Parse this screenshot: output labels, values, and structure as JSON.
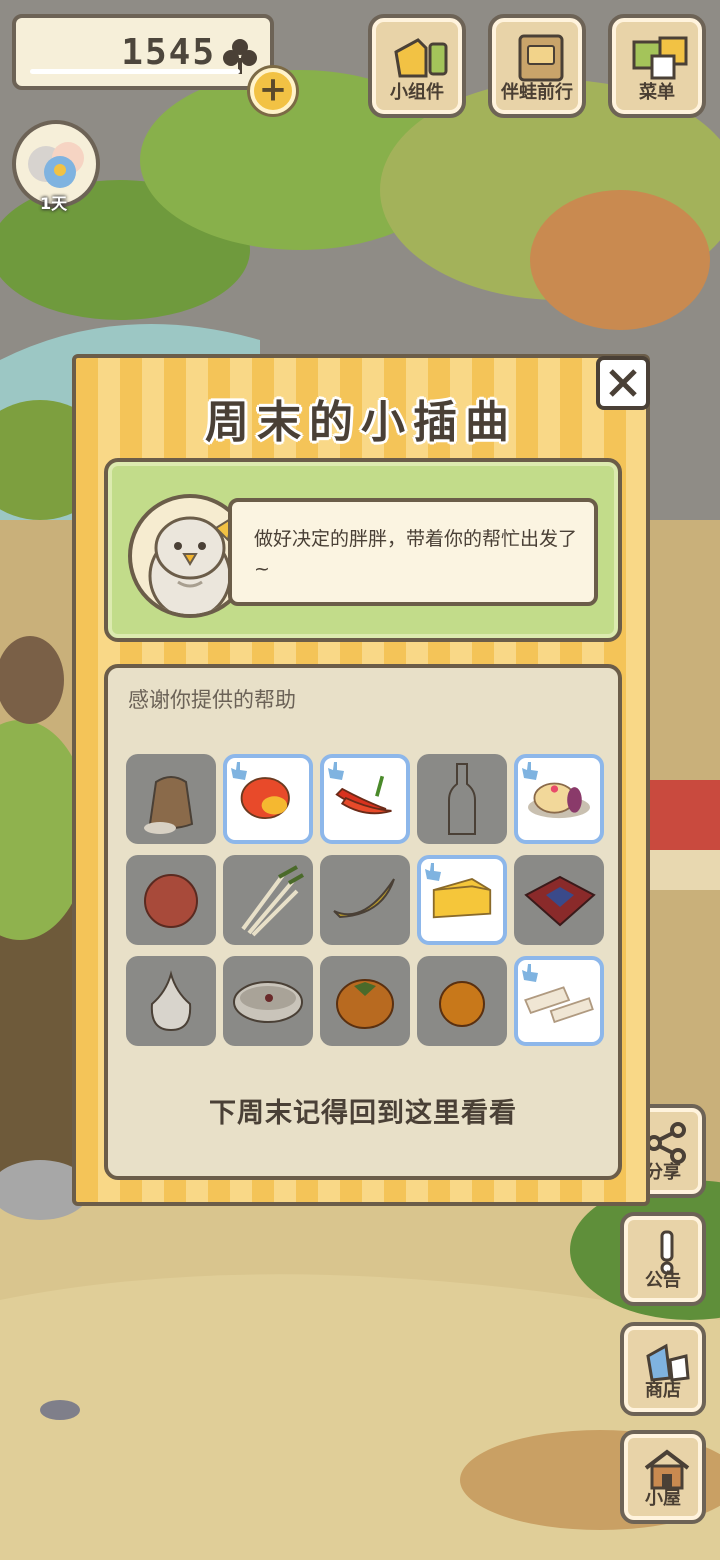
{
  "hud": {
    "clover_count": "1545",
    "clover_icon": "clover-icon",
    "plus_label": "+",
    "days_label": "1天"
  },
  "top_menu": [
    {
      "label": "小组件",
      "icon": "widget-icon"
    },
    {
      "label": "伴蛙前行",
      "icon": "book-icon"
    },
    {
      "label": "菜单",
      "icon": "menu-cards-icon"
    }
  ],
  "side_menu": [
    {
      "label": "分享",
      "icon": "share-icon"
    },
    {
      "label": "公告",
      "icon": "notice-icon"
    },
    {
      "label": "商店",
      "icon": "shop-bag-icon"
    },
    {
      "label": "小屋",
      "icon": "house-icon"
    }
  ],
  "modal": {
    "title": "周末的小插曲",
    "message": "做好决定的胖胖，带着你的帮忙出发了~",
    "thanks_heading": "感谢你提供的帮助",
    "footer": "下周末记得回到这里看看",
    "items": [
      {
        "name": "rice-sack",
        "given": false
      },
      {
        "name": "mango",
        "given": true
      },
      {
        "name": "chili-peppers",
        "given": true
      },
      {
        "name": "glass-bottle",
        "given": false
      },
      {
        "name": "pastry-cake",
        "given": true
      },
      {
        "name": "peach",
        "given": false
      },
      {
        "name": "green-onion",
        "given": false
      },
      {
        "name": "banana",
        "given": false
      },
      {
        "name": "cheese",
        "given": true
      },
      {
        "name": "gift-box",
        "given": false
      },
      {
        "name": "garlic",
        "given": false
      },
      {
        "name": "porridge-bowl",
        "given": false
      },
      {
        "name": "persimmon",
        "given": false
      },
      {
        "name": "orange",
        "given": false
      },
      {
        "name": "nougat",
        "given": true
      }
    ]
  },
  "colors": {
    "modal_stripe_a": "#f4c458",
    "modal_stripe_b": "#f9d887",
    "message_panel": "#c2dc8a",
    "given_border": "#8db7ea",
    "outline": "#6b5d49"
  }
}
